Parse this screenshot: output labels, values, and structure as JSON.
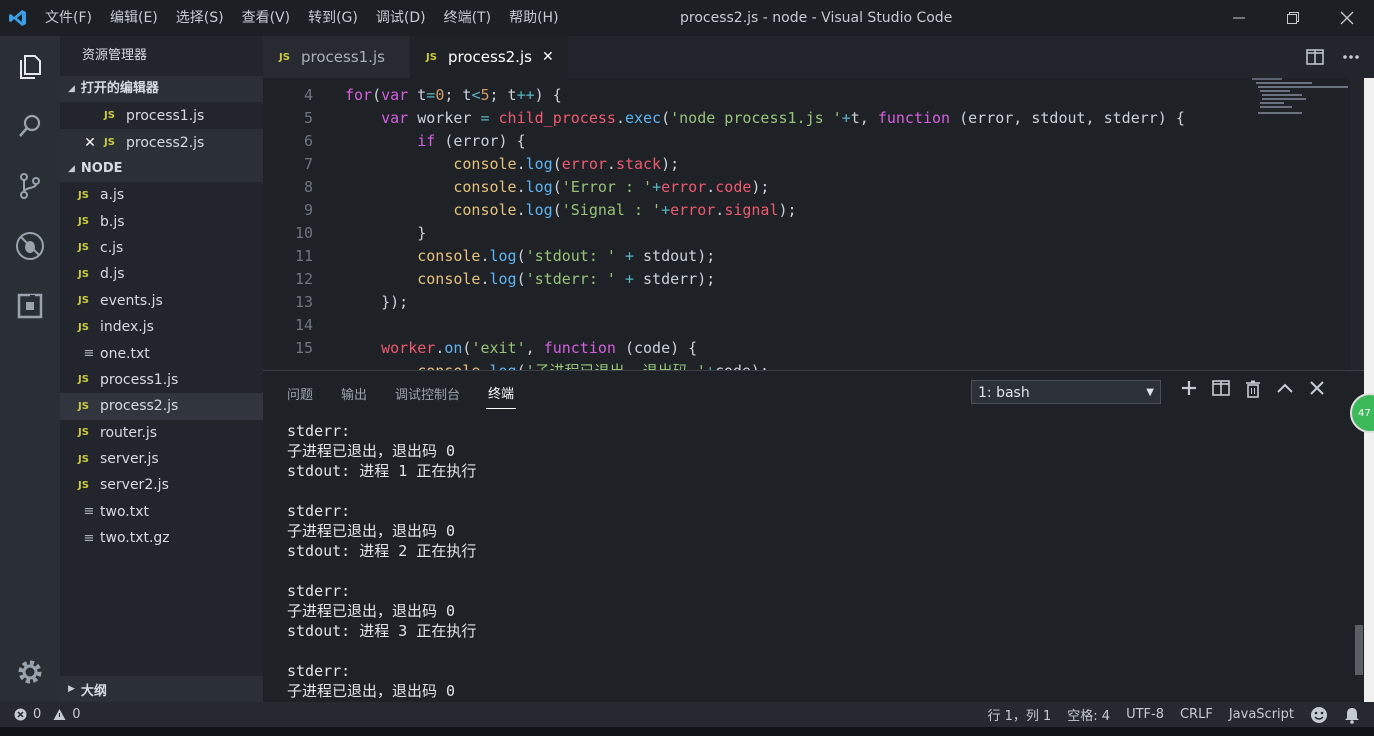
{
  "window": {
    "title": "process2.js - node - Visual Studio Code",
    "menu": [
      "文件(F)",
      "编辑(E)",
      "选择(S)",
      "查看(V)",
      "转到(G)",
      "调试(D)",
      "终端(T)",
      "帮助(H)"
    ]
  },
  "sidebar": {
    "title": "资源管理器",
    "open_editors_label": "打开的编辑器",
    "open_editors": [
      {
        "name": "process1.js",
        "badge": "JS"
      },
      {
        "name": "process2.js",
        "badge": "JS",
        "close": "✕"
      }
    ],
    "folder_label": "NODE",
    "files": [
      {
        "name": "a.js",
        "badge": "JS"
      },
      {
        "name": "b.js",
        "badge": "JS"
      },
      {
        "name": "c.js",
        "badge": "JS"
      },
      {
        "name": "d.js",
        "badge": "JS"
      },
      {
        "name": "events.js",
        "badge": "JS"
      },
      {
        "name": "index.js",
        "badge": "JS"
      },
      {
        "name": "one.txt",
        "badge": "≡"
      },
      {
        "name": "process1.js",
        "badge": "JS"
      },
      {
        "name": "process2.js",
        "badge": "JS"
      },
      {
        "name": "router.js",
        "badge": "JS"
      },
      {
        "name": "server.js",
        "badge": "JS"
      },
      {
        "name": "server2.js",
        "badge": "JS"
      },
      {
        "name": "two.txt",
        "badge": "≡"
      },
      {
        "name": "two.txt.gz",
        "badge": "≡"
      }
    ],
    "outline_label": "大纲"
  },
  "tabs": [
    {
      "label": "process1.js",
      "badge": "JS"
    },
    {
      "label": "process2.js",
      "badge": "JS",
      "close": "✕"
    }
  ],
  "editor": {
    "line_numbers": [
      "4",
      "5",
      "6",
      "7",
      "8",
      "9",
      "10",
      "11",
      "12",
      "13",
      "14",
      "15"
    ]
  },
  "panel": {
    "tabs": [
      "问题",
      "输出",
      "调试控制台",
      "终端"
    ],
    "terminal_select": "1: bash",
    "terminal_lines": [
      "stderr:",
      "子进程已退出，退出码 0",
      "stdout: 进程 1 正在执行",
      "",
      "stderr:",
      "子进程已退出，退出码 0",
      "stdout: 进程 2 正在执行",
      "",
      "stderr:",
      "子进程已退出，退出码 0",
      "stdout: 进程 3 正在执行",
      "",
      "stderr:",
      "子进程已退出，退出码 0"
    ]
  },
  "status": {
    "errors": "0",
    "warnings": "0",
    "position": "行 1，列 1",
    "spaces": "空格: 4",
    "encoding": "UTF-8",
    "eol": "CRLF",
    "language": "JavaScript"
  },
  "badge_number": "47"
}
